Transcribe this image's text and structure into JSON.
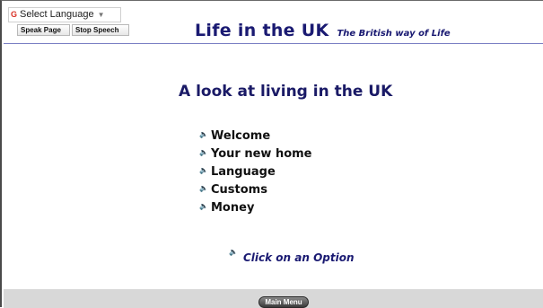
{
  "header": {
    "translate": {
      "icon": "google-g-icon",
      "label": "Select Language",
      "arrow": "▼"
    },
    "speak_page_label": "Speak Page",
    "stop_speech_label": "Stop Speech",
    "site_title": "Life in the UK",
    "tagline": "The British way of Life"
  },
  "main": {
    "title": "A look at living in the UK",
    "menu": [
      {
        "label": "Welcome",
        "icon": "speaker-icon"
      },
      {
        "label": "Your new home",
        "icon": "speaker-icon"
      },
      {
        "label": "Language",
        "icon": "speaker-icon"
      },
      {
        "label": "Customs",
        "icon": "speaker-icon"
      },
      {
        "label": "Money",
        "icon": "speaker-icon"
      }
    ],
    "prompt": "Click on an Option",
    "speaker_glyph": "🔈"
  },
  "footer": {
    "main_menu_label": "Main Menu"
  },
  "colors": {
    "title": "#1a1a72",
    "footer_bg": "#d8d8d8",
    "header_rule": "#7a7fc4"
  }
}
